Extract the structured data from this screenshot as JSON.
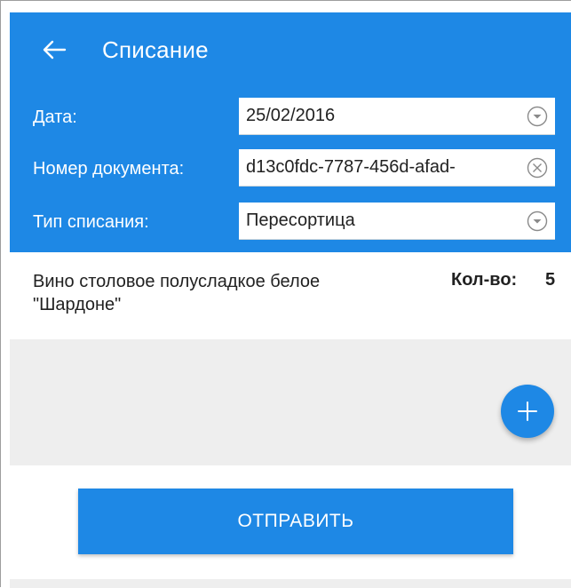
{
  "app": {
    "title": "Списание",
    "back_icon": "arrow-left-icon"
  },
  "form": {
    "date": {
      "label": "Дата:",
      "value": "25/02/2016",
      "icon": "chevron-down-circle-icon"
    },
    "document_number": {
      "label": "Номер документа:",
      "value": "d13c0fdc-7787-456d-afad-",
      "icon": "clear-circle-icon"
    },
    "writeoff_type": {
      "label": "Тип списания:",
      "value": "Пересортица",
      "icon": "chevron-down-circle-icon"
    }
  },
  "items": [
    {
      "name": "Вино столовое полусладкое белое \"Шардоне\"",
      "qty_label": "Кол-во:",
      "qty": "5"
    }
  ],
  "add_button": {
    "icon": "plus-icon"
  },
  "send_button": {
    "label": "ОТПРАВИТЬ"
  },
  "colors": {
    "primary": "#1e88e5",
    "background_grey": "#eeeeee",
    "text": "#212121"
  }
}
